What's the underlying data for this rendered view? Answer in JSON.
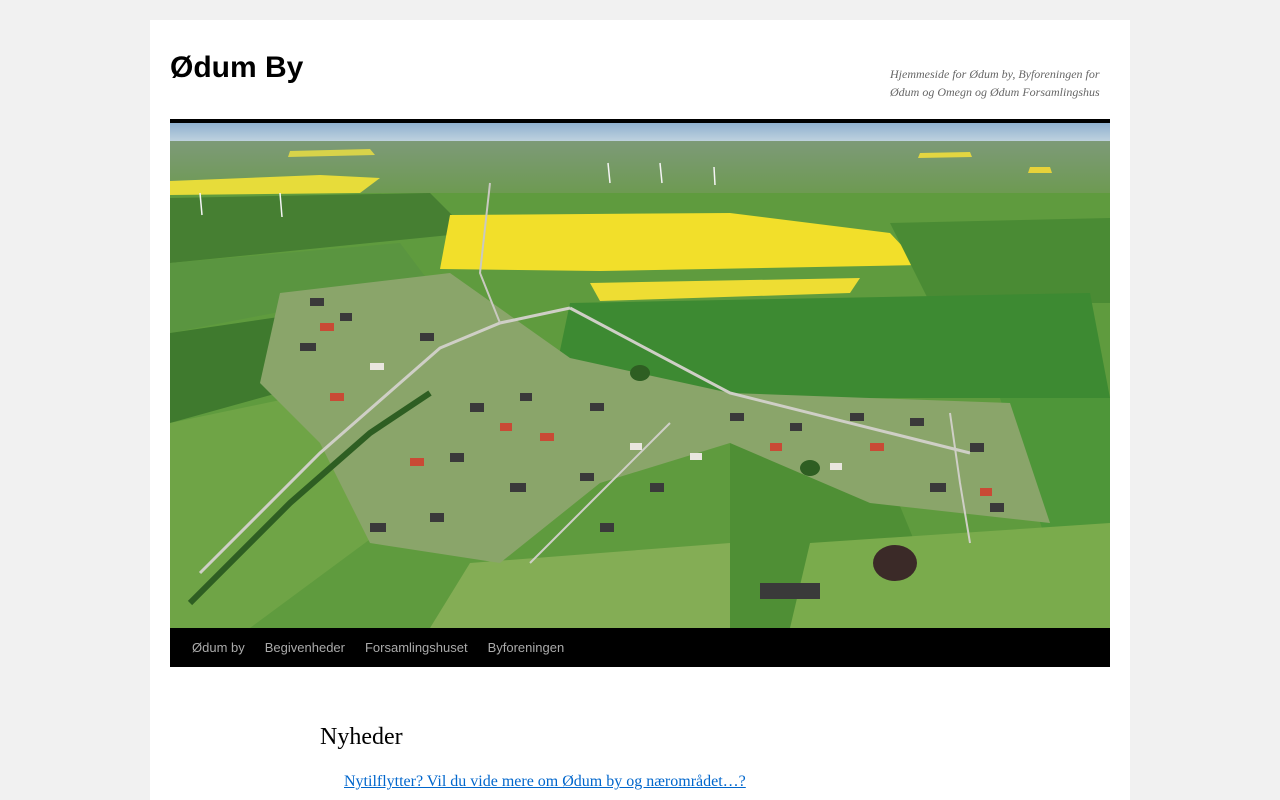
{
  "site": {
    "title": "Ødum By",
    "description": "Hjemmeside for Ødum by, Byforeningen for Ødum og Omegn og Ødum Forsamlingshus"
  },
  "header_image": {
    "depicts": "aerial-village-photo"
  },
  "nav": {
    "items": [
      {
        "label": "Ødum by"
      },
      {
        "label": "Begivenheder"
      },
      {
        "label": "Forsamlingshuset"
      },
      {
        "label": "Byforeningen"
      }
    ]
  },
  "main": {
    "title": "Nyheder",
    "items": [
      {
        "label": "Nytilflytter? Vil du vide mere om Ødum by og nærområdet…?"
      }
    ]
  },
  "colors": {
    "background": "#f1f1f1",
    "nav_background": "#000000",
    "nav_text": "#aaaaaa",
    "link": "#0066cc",
    "description": "#666666"
  }
}
